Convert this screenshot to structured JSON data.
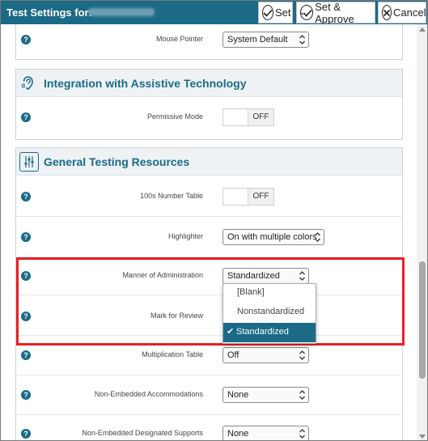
{
  "header": {
    "title": "Test Settings for:",
    "set_label": "Set",
    "set_approve_label": "Set & Approve",
    "cancel_label": "Cancel",
    "bg_color": "#1b6a86"
  },
  "settings_top": {
    "mouse_pointer": {
      "label": "Mouse Pointer",
      "value": "System Default"
    }
  },
  "sections": [
    {
      "title": "Integration with Assistive Technology",
      "icon": "ear-icon"
    },
    {
      "title": "General Testing Resources",
      "icon": "sliders-icon"
    }
  ],
  "rows": {
    "permissive_mode": {
      "label": "Permissive Mode",
      "value": "OFF"
    },
    "number_table": {
      "label": "100s Number Table",
      "value": "OFF"
    },
    "highlighter": {
      "label": "Highlighter",
      "value": "On with multiple colors"
    },
    "manner": {
      "label": "Manner of Administration",
      "value": "Standardized"
    },
    "mark_review": {
      "label": "Mark for Review"
    },
    "multiplication": {
      "label": "Multiplication Table",
      "value": "Off"
    },
    "non_embedded_acc": {
      "label": "Non-Embedded Accommodations",
      "value": "None"
    },
    "non_embedded_sup": {
      "label": "Non-Embedded Designated Supports",
      "value": "None"
    }
  },
  "help_glyph": "?",
  "dropdown": {
    "options": [
      "[Blank]",
      "Nonstandardized",
      "Standardized"
    ],
    "selected": "Standardized",
    "check": "✔"
  },
  "highlight_color": "#e81f26"
}
